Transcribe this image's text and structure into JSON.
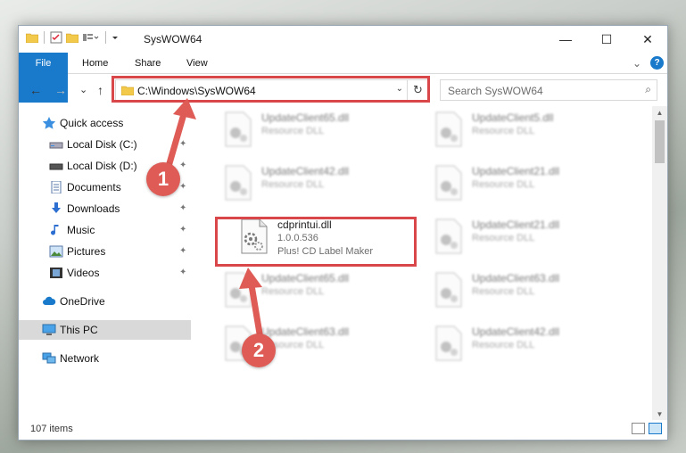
{
  "window": {
    "title": "SysWOW64",
    "min": "—",
    "max": "☐",
    "close": "✕"
  },
  "ribbon": {
    "tabs": [
      "File",
      "Home",
      "Share",
      "View"
    ],
    "collapse": "⌄",
    "help": "?"
  },
  "nav": {
    "back": "←",
    "forward": "→",
    "recent": "⌄",
    "up": "↑",
    "address": "C:\\Windows\\SysWOW64",
    "address_dropdown": "⌄",
    "refresh": "↻",
    "search_placeholder": "Search SysWOW64",
    "search_icon": "⌕"
  },
  "sidebar": {
    "items": [
      {
        "label": "Quick access",
        "icon": "star-icon"
      },
      {
        "label": "Local Disk (C:)",
        "icon": "drive-icon"
      },
      {
        "label": "Local Disk (D:)",
        "icon": "drive-icon"
      },
      {
        "label": "Documents",
        "icon": "documents-icon"
      },
      {
        "label": "Downloads",
        "icon": "download-icon"
      },
      {
        "label": "Music",
        "icon": "music-icon"
      },
      {
        "label": "Pictures",
        "icon": "pictures-icon"
      },
      {
        "label": "Videos",
        "icon": "videos-icon"
      },
      {
        "label": "OneDrive",
        "icon": "cloud-icon"
      },
      {
        "label": "This PC",
        "icon": "computer-icon"
      },
      {
        "label": "Network",
        "icon": "network-icon"
      }
    ]
  },
  "files": {
    "left": [
      {
        "name": "UpdateClient65.dll",
        "type": "Resource DLL"
      },
      {
        "name": "UpdateClient42.dll",
        "type": "Resource DLL"
      },
      {
        "name": "cdprintui.dll",
        "version": "1.0.0.536",
        "type": "Plus! CD Label Maker"
      },
      {
        "name": "UpdateClient65.dll",
        "type": "Resource DLL"
      },
      {
        "name": "UpdateClient63.dll",
        "type": "Resource DLL"
      }
    ],
    "right": [
      {
        "name": "UpdateClient5.dll",
        "type": "Resource DLL"
      },
      {
        "name": "UpdateClient21.dll",
        "type": "Resource DLL"
      },
      {
        "name": "UpdateClient21.dll",
        "type": "Resource DLL"
      },
      {
        "name": "UpdateClient63.dll",
        "type": "Resource DLL"
      },
      {
        "name": "UpdateClient42.dll",
        "type": "Resource DLL"
      }
    ]
  },
  "status": {
    "count": "107 items"
  },
  "annotations": {
    "step1": "1",
    "step2": "2",
    "color": "#d9474a"
  }
}
